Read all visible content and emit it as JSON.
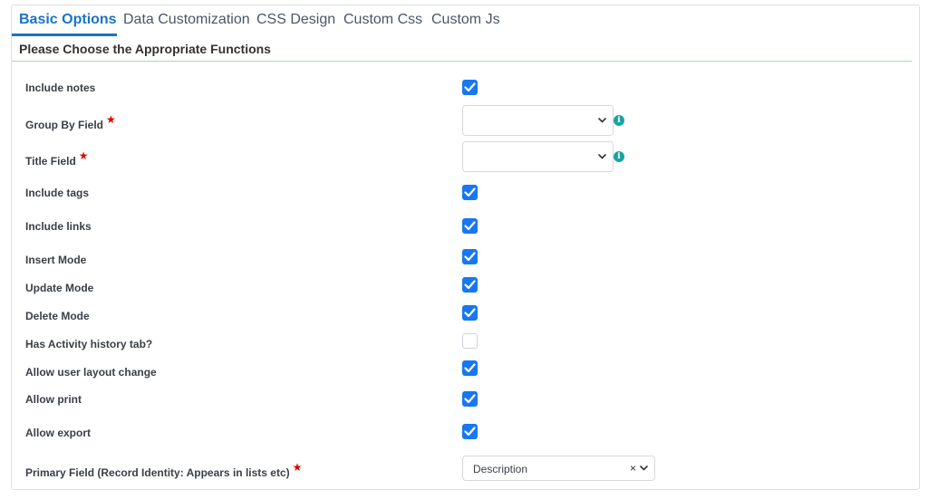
{
  "tabs": [
    {
      "label": "Basic Options",
      "active": true
    },
    {
      "label": "Data Customization",
      "active": false
    },
    {
      "label": "CSS Design",
      "active": false
    },
    {
      "label": "Custom Css",
      "active": false
    },
    {
      "label": "Custom Js",
      "active": false
    }
  ],
  "section_title": "Please Choose the Appropriate Functions",
  "required_marker": "★",
  "info_glyph": "i",
  "clear_glyph": "×",
  "fields": {
    "include_notes": {
      "label": "Include notes",
      "checked": true
    },
    "group_by_field": {
      "label": "Group By Field",
      "value": ""
    },
    "title_field": {
      "label": "Title Field",
      "value": ""
    },
    "include_tags": {
      "label": "Include tags",
      "checked": true
    },
    "include_links": {
      "label": "Include links",
      "checked": true
    },
    "insert_mode": {
      "label": "Insert Mode",
      "checked": true
    },
    "update_mode": {
      "label": "Update Mode",
      "checked": true
    },
    "delete_mode": {
      "label": "Delete Mode",
      "checked": true
    },
    "activity_history_tab": {
      "label": "Has Activity history tab?",
      "checked": false
    },
    "allow_layout_change": {
      "label": "Allow user layout change",
      "checked": true
    },
    "allow_print": {
      "label": "Allow print",
      "checked": true
    },
    "allow_export": {
      "label": "Allow export",
      "checked": true
    },
    "primary_field": {
      "label": "Primary Field (Record Identity: Appears in lists etc)",
      "value": "Description"
    }
  },
  "colors": {
    "accent": "#1a73c8",
    "checkbox_on": "#1877f2",
    "required": "#e00000",
    "info": "#1aa3a3",
    "section_rule": "#a9dba9"
  }
}
